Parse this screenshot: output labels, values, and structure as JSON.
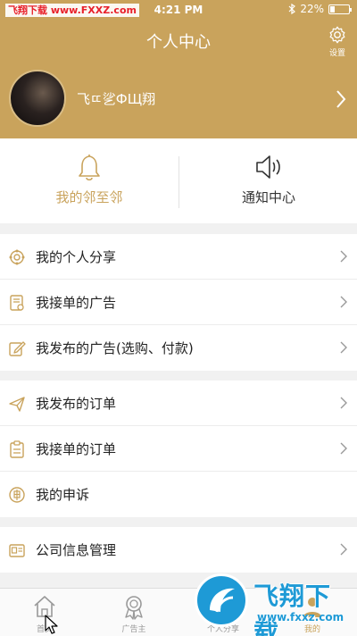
{
  "status_bar": {
    "watermark_text": "飞翔下载 www.FXXZ.com",
    "time": "4:21 PM",
    "battery": "22%",
    "icons": [
      "bluetooth-icon",
      "battery-icon"
    ]
  },
  "header": {
    "title": "个人中心",
    "settings_label": "设置",
    "username": "飞ㄸ乷ФЩ翔",
    "colors": {
      "brand": "#c9a35c"
    }
  },
  "quick": {
    "neighbors_label": "我的邻至邻",
    "notify_label": "通知中心"
  },
  "menu": {
    "group1": [
      {
        "label": "我的个人分享",
        "icon": "share-icon"
      },
      {
        "label": "我接单的广告",
        "icon": "ad-received-icon"
      },
      {
        "label": "我发布的广告(选购、付款)",
        "icon": "edit-icon"
      }
    ],
    "group2": [
      {
        "label": "我发布的订单",
        "icon": "send-icon"
      },
      {
        "label": "我接单的订单",
        "icon": "clipboard-icon"
      },
      {
        "label": "我的申诉",
        "icon": "appeal-icon"
      }
    ],
    "group3": [
      {
        "label": "公司信息管理",
        "icon": "company-icon"
      }
    ]
  },
  "tabbar": {
    "tabs": [
      {
        "label": "首页",
        "icon": "home-icon"
      },
      {
        "label": "广告主",
        "icon": "badge-icon"
      },
      {
        "label": "个人分享",
        "icon": "share-tab-icon"
      },
      {
        "label": "我的",
        "icon": "profile-tab-icon",
        "active": true
      }
    ]
  },
  "watermark": {
    "text": "飞翔下载",
    "url": "www.fxxz.com"
  }
}
